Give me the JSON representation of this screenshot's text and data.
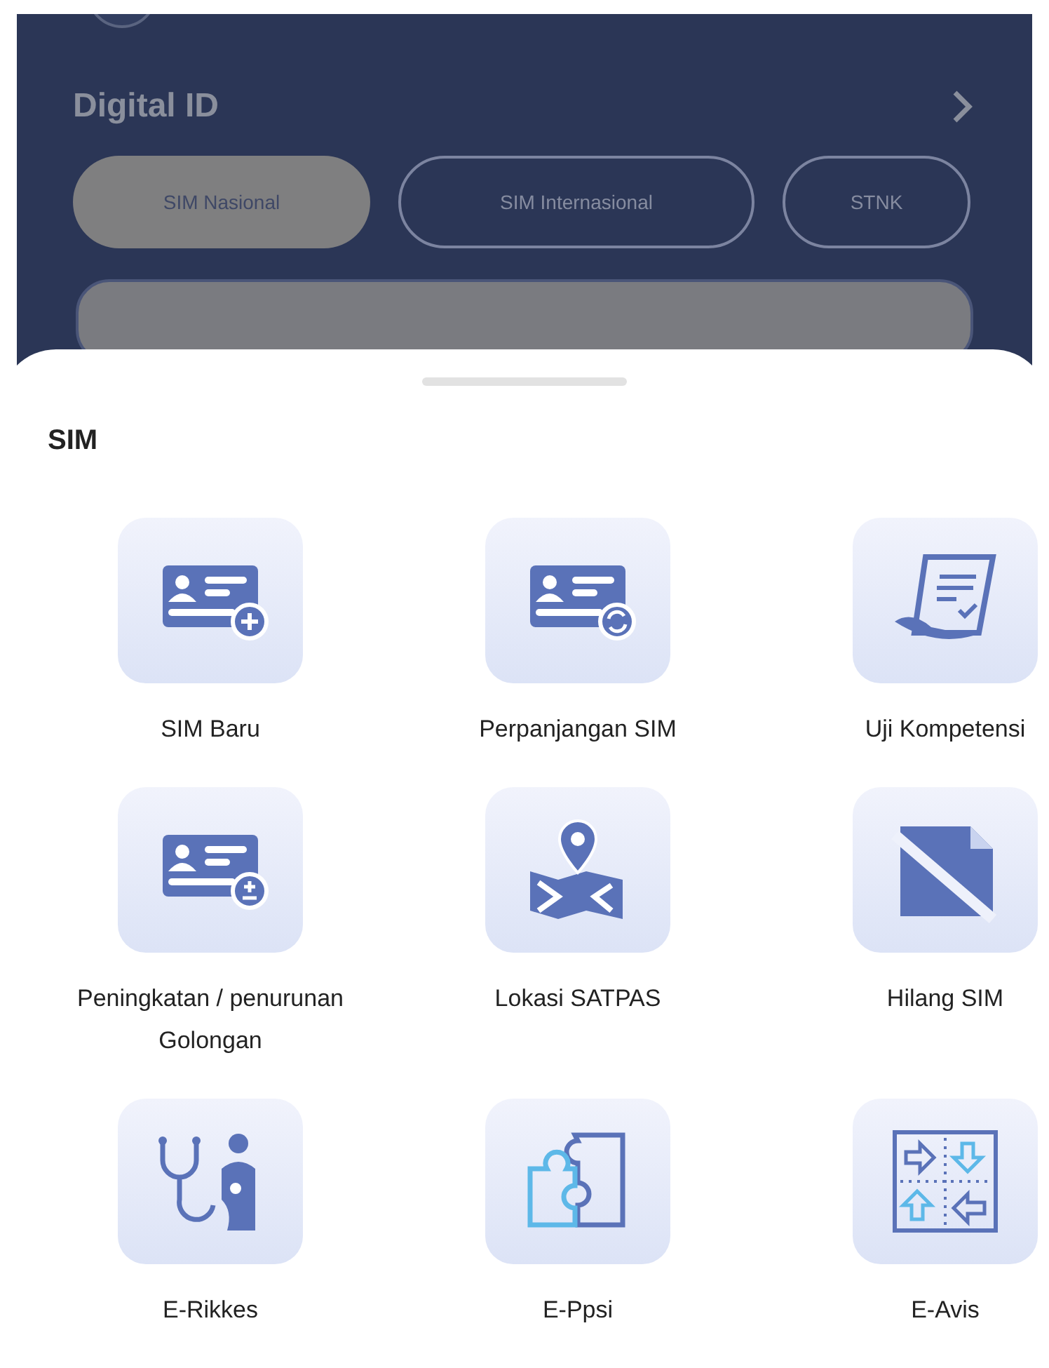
{
  "digital_id": {
    "title": "Digital ID"
  },
  "tabs": [
    {
      "label": "SIM Nasional",
      "selected": true
    },
    {
      "label": "SIM Internasional",
      "selected": false
    },
    {
      "label": "STNK",
      "selected": false
    }
  ],
  "section": {
    "title": "SIM"
  },
  "services": [
    {
      "kind": "card-plus",
      "label": "SIM Baru"
    },
    {
      "kind": "card-refresh",
      "label": "Perpanjangan SIM"
    },
    {
      "kind": "scroll",
      "label": "Uji Kompetensi"
    },
    {
      "kind": "card-plusminus",
      "label": "Peningkatan / penurunan Golongan"
    },
    {
      "kind": "map",
      "label": "Lokasi SATPAS"
    },
    {
      "kind": "lost-card",
      "label": "Hilang SIM"
    },
    {
      "kind": "stethoscope",
      "label": "E-Rikkes"
    },
    {
      "kind": "puzzle",
      "label": "E-Ppsi"
    },
    {
      "kind": "arrows",
      "label": "E-Avis"
    }
  ]
}
